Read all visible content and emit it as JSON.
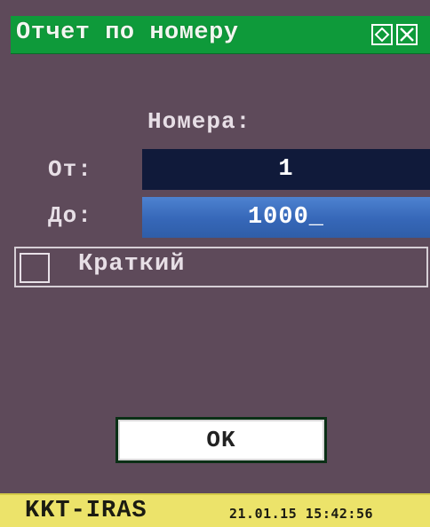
{
  "window": {
    "title": "Отчет по номеру",
    "buttons": [
      {
        "icon": "diamond-icon"
      },
      {
        "icon": "close-icon"
      }
    ]
  },
  "colors": {
    "background": "#5e4a5a",
    "titlebar": "#0e9a3a",
    "statusbar": "#ece36a",
    "field_from_bg": "#101a3a",
    "field_to_bg": "#3667b8"
  },
  "form": {
    "caption": "Номера:",
    "from": {
      "label": "От:",
      "value": "1"
    },
    "to": {
      "label": "До:",
      "value": "1000_"
    },
    "brief": {
      "label": "Краткий",
      "checked": false
    },
    "ok_label": "OK"
  },
  "statusbar": {
    "device": "KKT-IRAS",
    "datetime": "21.01.15 15:42:56"
  }
}
